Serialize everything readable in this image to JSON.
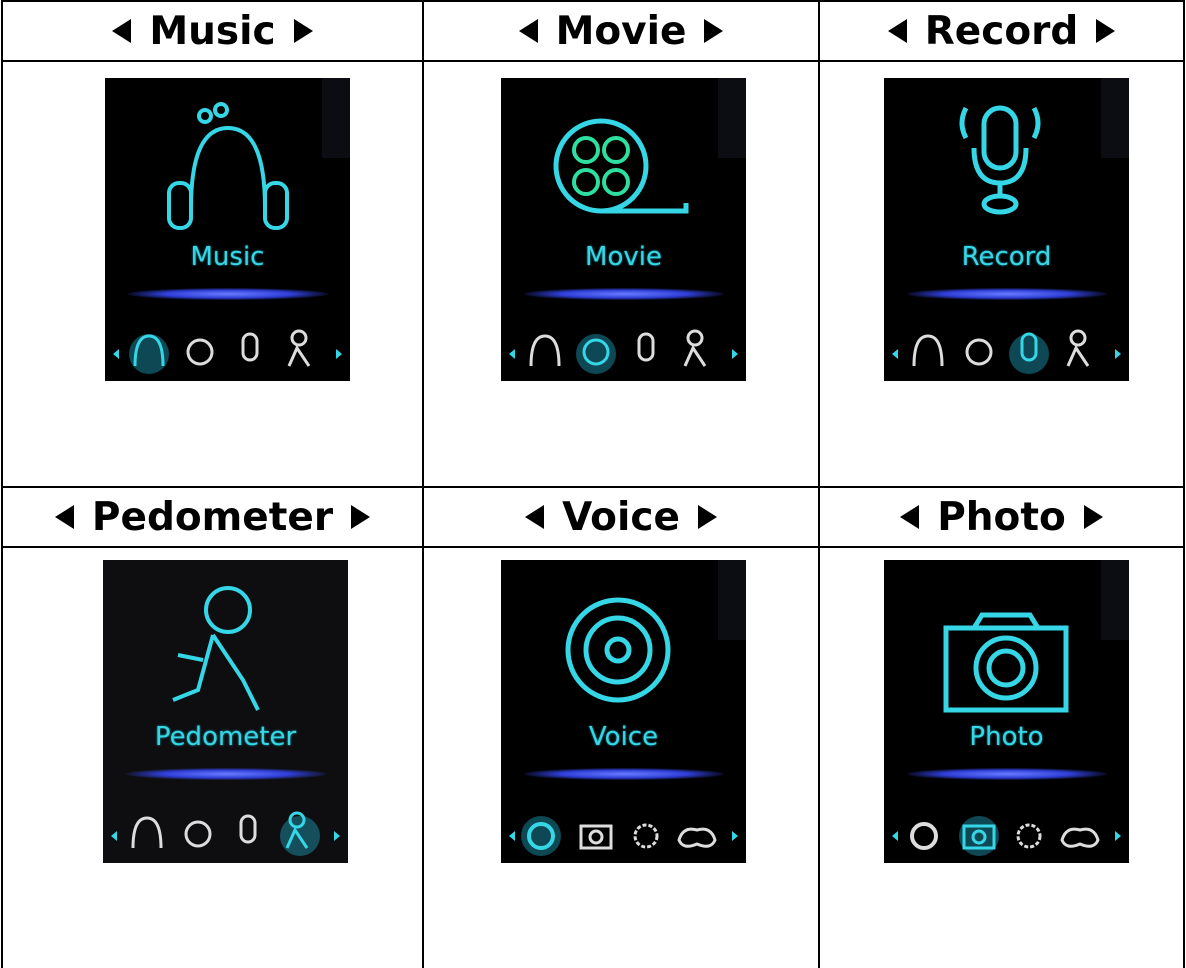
{
  "colors": {
    "accent": "#35d6e6",
    "screen_bg": "#000000",
    "glow": "#4b5cff",
    "grid": "#000000"
  },
  "cells": [
    {
      "header": "Music",
      "caption": "Music",
      "main_icon": "headphones-icon",
      "bar_icons": [
        "music-icon",
        "movie-icon",
        "record-icon",
        "pedometer-icon"
      ],
      "selected": 0
    },
    {
      "header": "Movie",
      "caption": "Movie",
      "main_icon": "film-reel-icon",
      "bar_icons": [
        "music-icon",
        "movie-icon",
        "record-icon",
        "pedometer-icon"
      ],
      "selected": 1
    },
    {
      "header": "Record",
      "caption": "Record",
      "main_icon": "microphone-icon",
      "bar_icons": [
        "music-icon",
        "movie-icon",
        "record-icon",
        "pedometer-icon"
      ],
      "selected": 2
    },
    {
      "header": "Pedometer",
      "caption": "Pedometer",
      "main_icon": "running-man-icon",
      "bar_icons": [
        "music-icon",
        "movie-icon",
        "record-icon",
        "pedometer-icon"
      ],
      "selected": 3
    },
    {
      "header": "Voice",
      "caption": "Voice",
      "main_icon": "voice-disc-icon",
      "bar_icons": [
        "voice-icon",
        "photo-icon",
        "settings-icon",
        "game-icon"
      ],
      "selected": 0
    },
    {
      "header": "Photo",
      "caption": "Photo",
      "main_icon": "camera-icon",
      "bar_icons": [
        "voice-icon",
        "photo-icon",
        "settings-icon",
        "game-icon"
      ],
      "selected": 1
    }
  ]
}
